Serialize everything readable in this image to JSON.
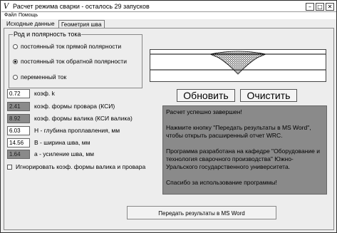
{
  "window": {
    "title": "Расчет режима сварки - осталось 29 запусков",
    "minimize_glyph": "–",
    "maximize_glyph": "□",
    "close_glyph": "✕"
  },
  "menu": {
    "items": [
      "Файл",
      "Помощь"
    ]
  },
  "tabs": [
    {
      "label": "Исходные данные",
      "active": false
    },
    {
      "label": "Геометрия шва",
      "active": true
    }
  ],
  "current_group": {
    "title": "Род и полярность тока",
    "options": [
      {
        "label": "постоянный ток прямой полярности",
        "checked": false
      },
      {
        "label": "постоянный ток обратной полярности",
        "checked": true
      },
      {
        "label": "переменный ток",
        "checked": false
      }
    ]
  },
  "buttons": {
    "refresh": "Обновить",
    "clear": "Очистить",
    "send": "Передать результаты в MS Word"
  },
  "fields": [
    {
      "value": "0.72",
      "label": "коэф. k",
      "readonly": false
    },
    {
      "value": "2.41",
      "label": "коэф. формы провара (КСИ)",
      "readonly": true
    },
    {
      "value": "8.92",
      "label": "коэф. формы валика (КСИ валика)",
      "readonly": true
    },
    {
      "value": "6.03",
      "label": "H - глубина проплавления, мм",
      "readonly": false
    },
    {
      "value": "14.56",
      "label": "B - ширина шва, мм",
      "readonly": false
    },
    {
      "value": "1.64",
      "label": "a - усиление шва, мм",
      "readonly": true
    }
  ],
  "ignore_checkbox": {
    "label": "Игнорировать коэф. формы валика и провара",
    "checked": false
  },
  "result": {
    "lines": [
      "Расчет успешно завершен!",
      "Нажмите кнопку \"Передать результаты в MS Word\", чтобы открыть расширенный отчет WRC.",
      "Программа разработана на кафедре \"Оборудование и технология сварочного производства\" Южно-Уральского государственного университета.",
      "Спасибо за использование программы!"
    ]
  },
  "colors": {
    "result_bg": "#8a8a8a",
    "readonly_field_bg": "#8a8a8a",
    "window_bg": "#ededed"
  }
}
